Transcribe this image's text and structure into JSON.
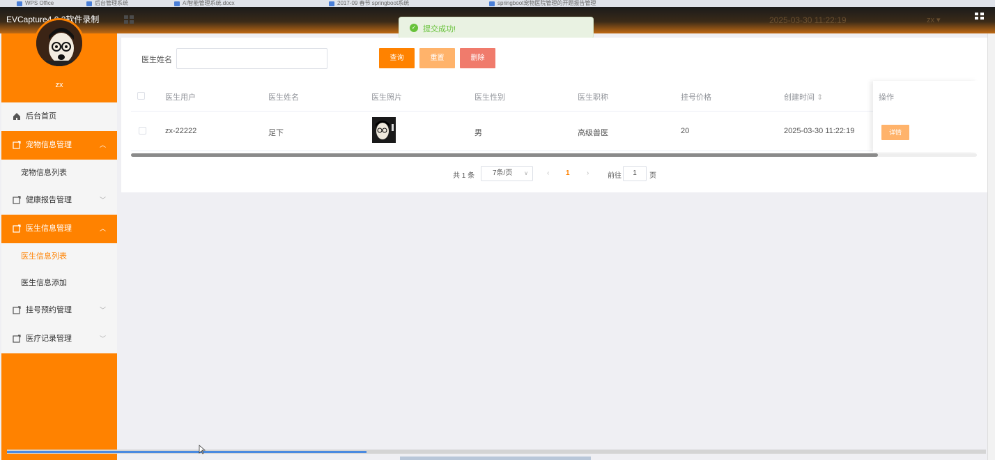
{
  "os_tabs": [
    "WPS Office",
    "后台管理系统",
    "AI智能管理系统.docx",
    "2017-09 春节 springboot系统",
    "springboot宠物医院管理的开题报告管理",
    "EVCapture"
  ],
  "capture_label": "EVCapture4.0.2软件录制",
  "header": {
    "time": "2025-03-30 11:22:19",
    "user": "zx ▾"
  },
  "toast": {
    "text": "提交成功!"
  },
  "sidebar": {
    "username": "zx",
    "items": [
      {
        "label": "后台首页"
      },
      {
        "label": "宠物信息管理"
      },
      {
        "label": "宠物信息列表"
      },
      {
        "label": "健康报告管理"
      },
      {
        "label": "医生信息管理"
      },
      {
        "label": "医生信息列表"
      },
      {
        "label": "医生信息添加"
      },
      {
        "label": "挂号预约管理"
      },
      {
        "label": "医疗记录管理"
      }
    ]
  },
  "search": {
    "label": "医生姓名",
    "value": "",
    "placeholder": ""
  },
  "buttons": {
    "query": "查询",
    "reset": "重置",
    "delete": "删除",
    "detail": "详情"
  },
  "table": {
    "headers": [
      "医生用户",
      "医生姓名",
      "医生照片",
      "医生性别",
      "医生职称",
      "挂号价格",
      "创建时间",
      "操作"
    ],
    "sort_icon": "⇕",
    "rows": [
      {
        "user": "zx-22222",
        "name": "足下",
        "gender": "男",
        "title": "高级兽医",
        "price": "20",
        "created": "2025-03-30 11:22:19"
      }
    ]
  },
  "pager": {
    "total": "共 1 条",
    "size": "7条/页",
    "current": "1",
    "goto": "前往",
    "goto_value": "1",
    "page": "页"
  },
  "colors": {
    "accent": "#ff8200",
    "reset": "#ffb36b",
    "delete": "#f07b6c",
    "success": "#67c23a"
  }
}
